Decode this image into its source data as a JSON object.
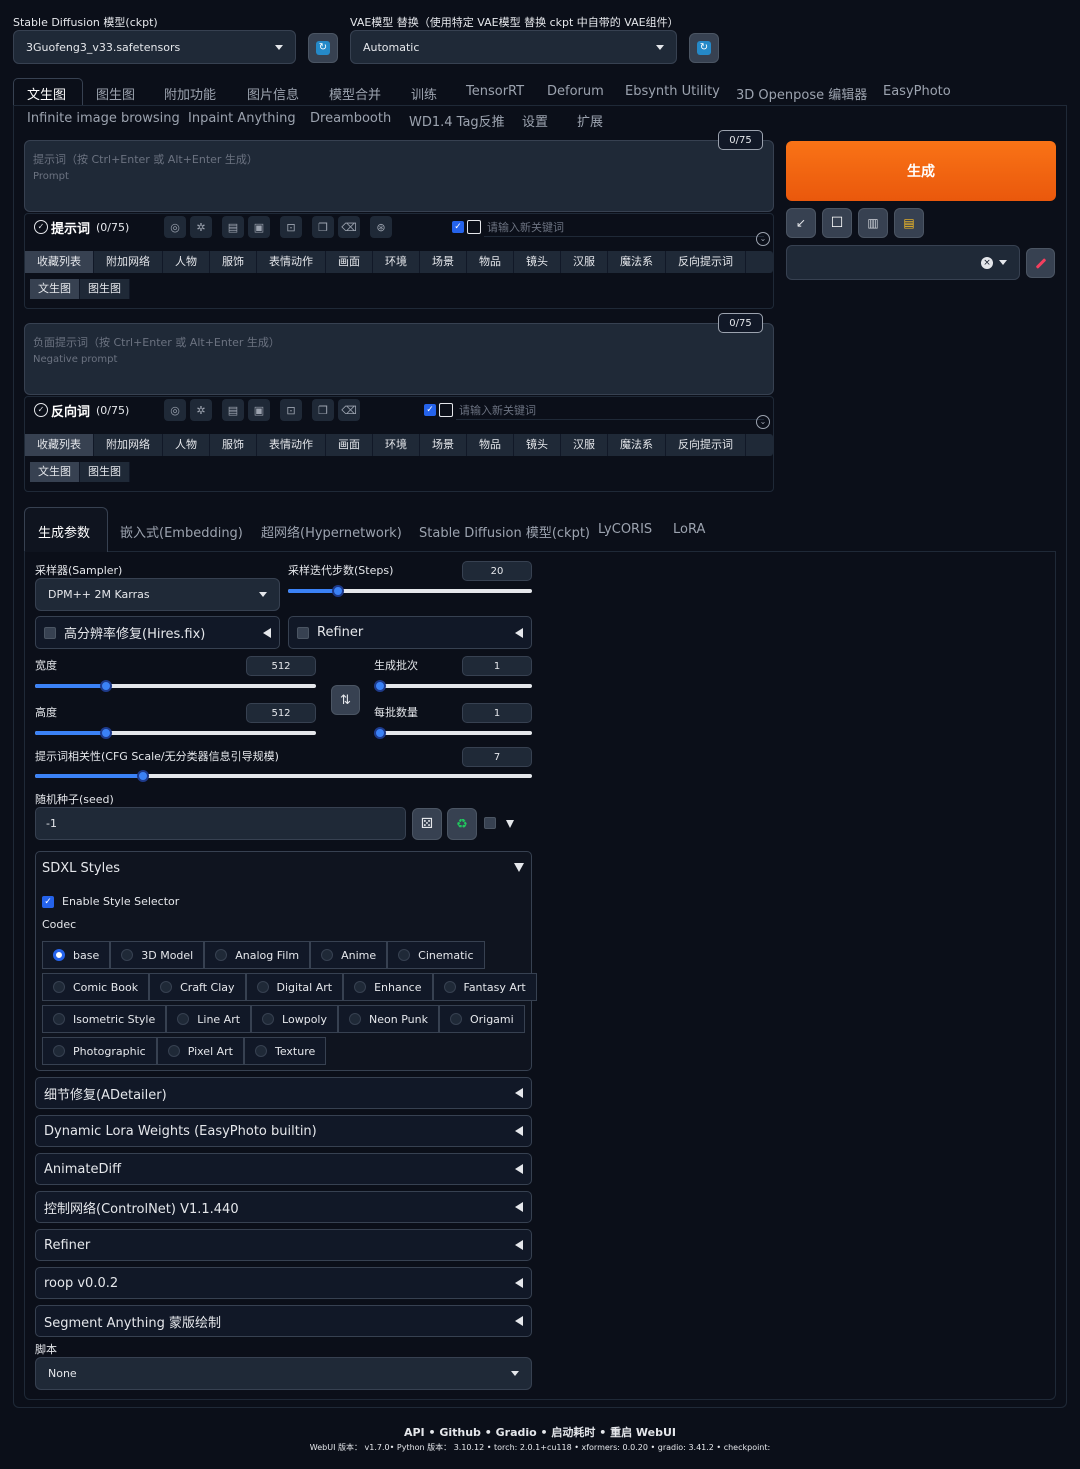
{
  "top": {
    "ckpt_label": "Stable Diffusion 模型(ckpt)",
    "ckpt_value": "3Guofeng3_v33.safetensors",
    "vae_label": "VAE模型 替换（使用特定 VAE模型 替换 ckpt 中自带的 VAE组件）",
    "vae_value": "Automatic"
  },
  "main_tabs_row1": [
    "文生图",
    "图生图",
    "附加功能",
    "图片信息",
    "模型合并",
    "训练",
    "TensorRT",
    "Deforum",
    "Ebsynth Utility",
    "3D Openpose 编辑器",
    "EasyPhoto"
  ],
  "main_tabs_row2": [
    "Infinite image browsing",
    "Inpaint Anything",
    "Dreambooth",
    "WD1.4 Tag反推",
    "设置",
    "扩展"
  ],
  "prompt": {
    "placeholder": "提示词（按 Ctrl+Enter 或 Alt+Enter 生成）",
    "placeholder_en": "Prompt",
    "counter": "0/75",
    "label": "提示词",
    "count": "(0/75)",
    "keyword_placeholder": "请输入新关键词"
  },
  "negative": {
    "placeholder": "负面提示词（按 Ctrl+Enter 或 Alt+Enter 生成）",
    "placeholder_en": "Negative prompt",
    "counter": "0/75",
    "label": "反向词",
    "count": "(0/75)",
    "keyword_placeholder": "请输入新关键词"
  },
  "category_tabs": [
    "收藏列表",
    "附加网络",
    "人物",
    "服饰",
    "表情动作",
    "画面",
    "环境",
    "场景",
    "物品",
    "镜头",
    "汉服",
    "魔法系",
    "反向提示词"
  ],
  "mode_tabs": [
    "文生图",
    "图生图"
  ],
  "generate_label": "生成",
  "param_tabs": [
    "生成参数",
    "嵌入式(Embedding)",
    "超网络(Hypernetwork)",
    "Stable Diffusion 模型(ckpt)",
    "LyCORIS",
    "LoRA"
  ],
  "params": {
    "sampler_label": "采样器(Sampler)",
    "sampler_value": "DPM++ 2M Karras",
    "steps_label": "采样迭代步数(Steps)",
    "steps_value": "20",
    "steps_fraction": 0.19,
    "hires_label": "高分辨率修复(Hires.fix)",
    "refiner_label": "Refiner",
    "width_label": "宽度",
    "width_value": "512",
    "width_fraction": 0.24,
    "height_label": "高度",
    "height_value": "512",
    "height_fraction": 0.24,
    "batch_count_label": "生成批次",
    "batch_count_value": "1",
    "batch_count_fraction": 0.0,
    "batch_size_label": "每批数量",
    "batch_size_value": "1",
    "batch_size_fraction": 0.0,
    "cfg_label": "提示词相关性(CFG Scale/无分类器信息引导规模)",
    "cfg_value": "7",
    "cfg_fraction": 0.21,
    "seed_label": "随机种子(seed)",
    "seed_value": "-1"
  },
  "sdxl": {
    "title": "SDXL Styles",
    "enable_label": "Enable Style Selector",
    "codec_label": "Codec",
    "styles": [
      [
        "base",
        "3D Model",
        "Analog Film",
        "Anime",
        "Cinematic"
      ],
      [
        "Comic Book",
        "Craft Clay",
        "Digital Art",
        "Enhance",
        "Fantasy Art"
      ],
      [
        "Isometric Style",
        "Line Art",
        "Lowpoly",
        "Neon Punk",
        "Origami"
      ],
      [
        "Photographic",
        "Pixel Art",
        "Texture"
      ]
    ],
    "selected": "base"
  },
  "accordions": [
    "细节修复(ADetailer)",
    "Dynamic Lora Weights (EasyPhoto builtin)",
    "AnimateDiff",
    "控制网络(ControlNet) V1.1.440",
    "Refiner",
    "roop v0.0.2",
    "Segment Anything 蒙版绘制"
  ],
  "script": {
    "label": "脚本",
    "value": "None"
  },
  "footer": {
    "links": "API  •  Github  •  Gradio  •  启动耗时  •  重启 WebUI",
    "versions": "WebUI 版本： v1.7.0•  Python 版本： 3.10.12  •  torch: 2.0.1+cu118  •  xformers: 0.0.20  •  gradio: 3.41.2  •  checkpoint:"
  },
  "colors": {
    "generate": "#f97316",
    "accent": "#3b82f6",
    "background": "#0b0f19"
  }
}
